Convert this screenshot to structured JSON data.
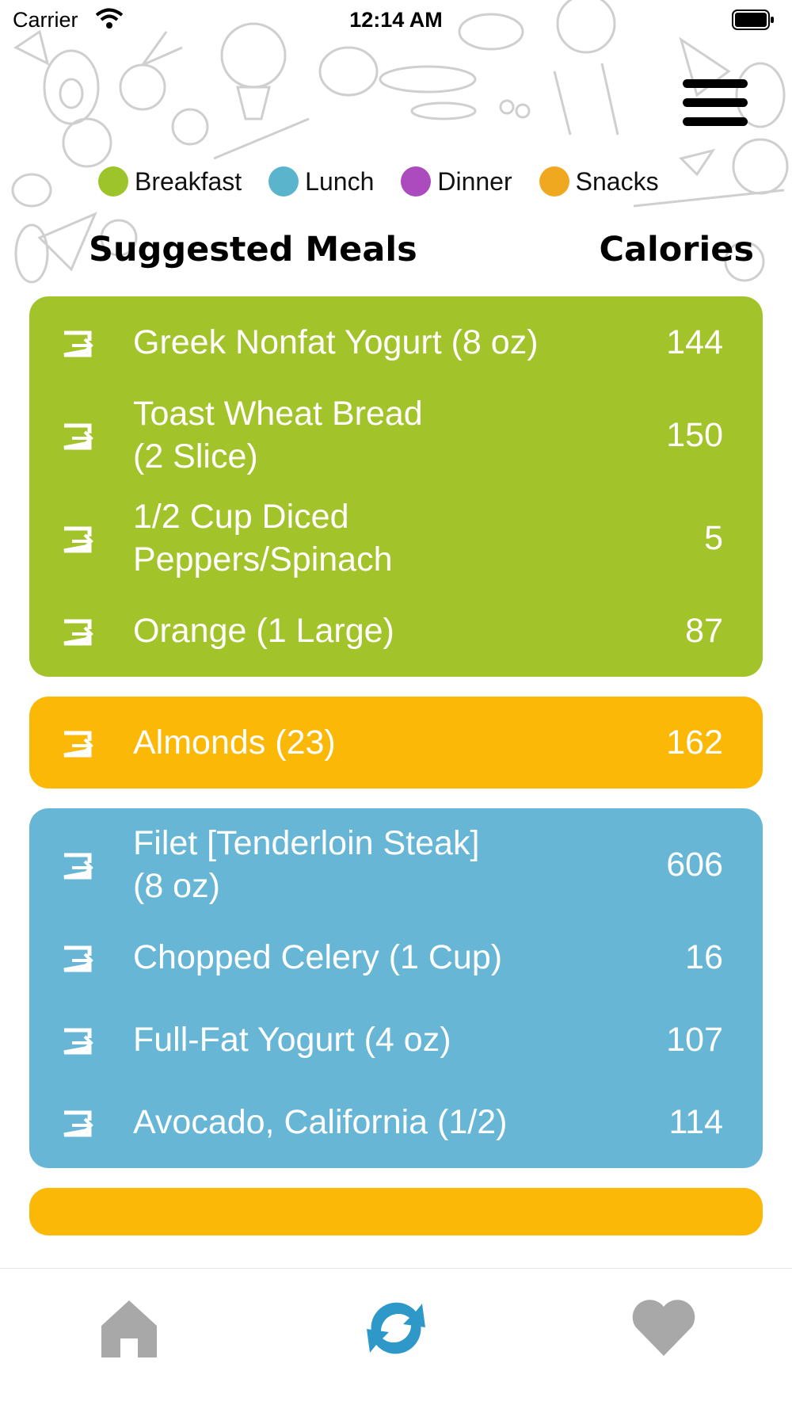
{
  "status_bar": {
    "carrier": "Carrier",
    "time": "12:14 AM"
  },
  "legend": [
    {
      "label": "Breakfast",
      "color": "#9dc42a"
    },
    {
      "label": "Lunch",
      "color": "#5ab4cc"
    },
    {
      "label": "Dinner",
      "color": "#ab4bbd"
    },
    {
      "label": "Snacks",
      "color": "#f0a820"
    }
  ],
  "header": {
    "meals_label": "Suggested Meals",
    "calories_label": "Calories"
  },
  "groups": [
    {
      "meal": "Breakfast",
      "color": "#a3c32a",
      "items": [
        {
          "name_line1": "Greek Nonfat Yogurt (8 oz)",
          "name_line2": "",
          "calories": "144"
        },
        {
          "name_line1": "Toast Wheat Bread",
          "name_line2": "(2 Slice)",
          "calories": "150"
        },
        {
          "name_line1": "1/2 Cup Diced",
          "name_line2": "Peppers/Spinach",
          "calories": "5"
        },
        {
          "name_line1": "Orange (1 Large)",
          "name_line2": "",
          "calories": "87"
        }
      ]
    },
    {
      "meal": "Snacks",
      "color": "#fbb806",
      "items": [
        {
          "name_line1": "Almonds (23)",
          "name_line2": "",
          "calories": "162"
        }
      ]
    },
    {
      "meal": "Lunch",
      "color": "#67b6d6",
      "items": [
        {
          "name_line1": "Filet [Tenderloin Steak]",
          "name_line2": "(8 oz)",
          "calories": "606"
        },
        {
          "name_line1": "Chopped Celery (1 Cup)",
          "name_line2": "",
          "calories": "16"
        },
        {
          "name_line1": "Full-Fat Yogurt (4 oz)",
          "name_line2": "",
          "calories": "107"
        },
        {
          "name_line1": "Avocado, California (1/2)",
          "name_line2": "",
          "calories": "114"
        }
      ]
    },
    {
      "meal": "Snacks",
      "color": "#fbb806",
      "items": []
    }
  ],
  "icons": {
    "row": "swap-item-icon",
    "menu": "hamburger-menu-icon",
    "tabs": [
      "home-icon",
      "refresh-icon",
      "heart-icon"
    ]
  },
  "tab_colors": {
    "inactive": "#a8a8a8",
    "active": "#2e98c8"
  }
}
